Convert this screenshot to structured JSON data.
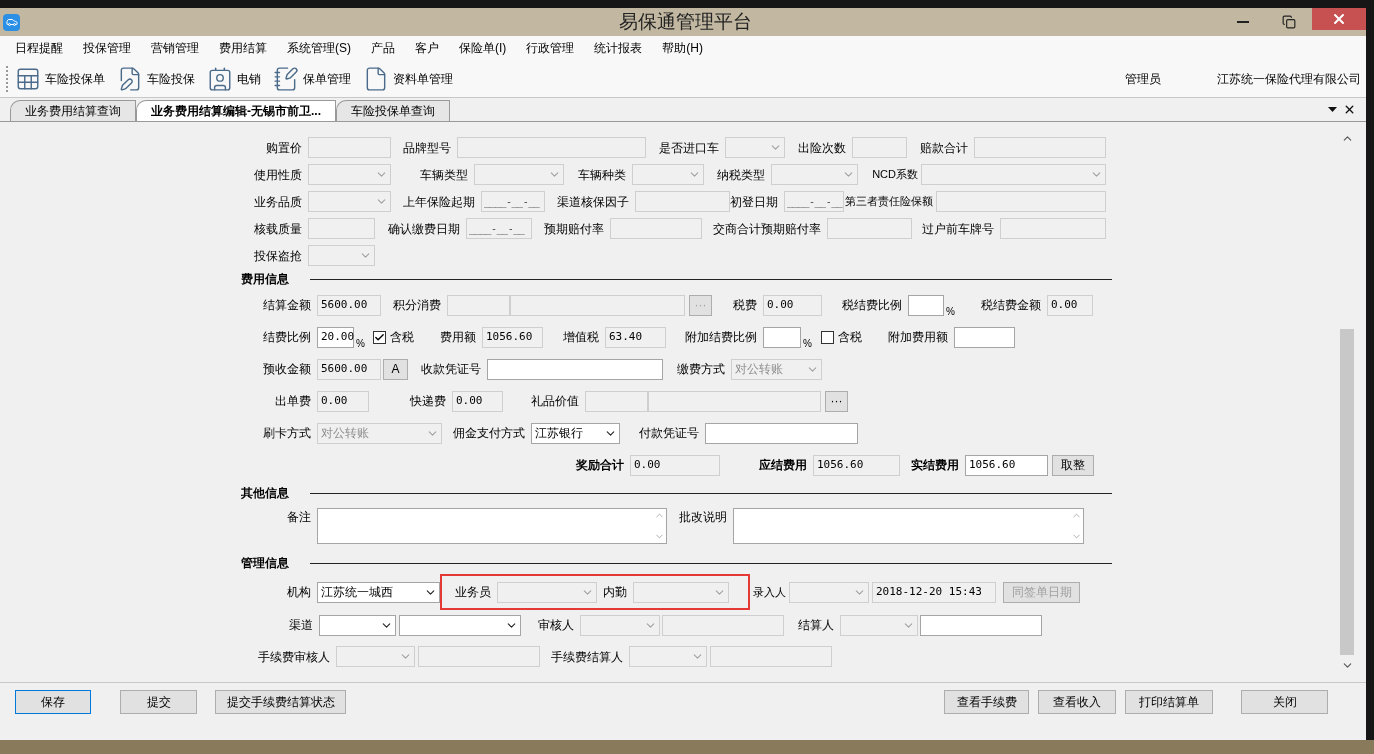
{
  "window": {
    "title": "易保通管理平台"
  },
  "menu": [
    "日程提醒",
    "投保管理",
    "营销管理",
    "费用结算",
    "系统管理(S)",
    "产品",
    "客户",
    "保险单(I)",
    "行政管理",
    "统计报表",
    "帮助(H)"
  ],
  "toolbar": {
    "items": [
      "车险投保单",
      "车险投保",
      "电销",
      "保单管理",
      "资料单管理"
    ],
    "user": "管理员",
    "company": "江苏统一保险代理有限公司"
  },
  "tabs": [
    {
      "label": "业务费用结算查询",
      "selected": false
    },
    {
      "label": "业务费用结算编辑-无锡市前卫...",
      "selected": true
    },
    {
      "label": "车险投保单查询",
      "selected": false
    }
  ],
  "form": {
    "sections": [
      {
        "rows": [
          {
            "items": [
              {
                "kind": "label",
                "text": "购置价"
              },
              {
                "kind": "text",
                "disabled": true
              },
              {
                "kind": "label",
                "text": "品牌型号"
              },
              {
                "kind": "text",
                "disabled": true
              },
              {
                "kind": "label",
                "text": "是否进口车"
              },
              {
                "kind": "select",
                "disabled": true
              },
              {
                "kind": "label",
                "text": "出险次数"
              },
              {
                "kind": "text",
                "disabled": true
              },
              {
                "kind": "label",
                "text": "赔款合计"
              },
              {
                "kind": "text",
                "disabled": true
              }
            ]
          },
          {
            "items": [
              {
                "kind": "label",
                "text": "使用性质"
              },
              {
                "kind": "select",
                "disabled": true
              },
              {
                "kind": "label",
                "text": "车辆类型"
              },
              {
                "kind": "select",
                "disabled": true
              },
              {
                "kind": "label",
                "text": "车辆种类"
              },
              {
                "kind": "select",
                "disabled": true
              },
              {
                "kind": "label",
                "text": "纳税类型"
              },
              {
                "kind": "select",
                "disabled": true
              },
              {
                "kind": "label",
                "text": "NCD系数"
              },
              {
                "kind": "select",
                "disabled": true
              }
            ]
          },
          {
            "items": [
              {
                "kind": "label",
                "text": "业务品质"
              },
              {
                "kind": "select",
                "disabled": true
              },
              {
                "kind": "label",
                "text": "上年保险起期"
              },
              {
                "kind": "date",
                "value": "____-__-__",
                "disabled": true
              },
              {
                "kind": "label",
                "text": "渠道核保因子"
              },
              {
                "kind": "text",
                "disabled": true
              },
              {
                "kind": "label",
                "text": "初登日期"
              },
              {
                "kind": "date",
                "value": "____-__-__",
                "disabled": true
              },
              {
                "kind": "label",
                "text": "第三者责任险保额"
              },
              {
                "kind": "text",
                "disabled": true
              }
            ]
          },
          {
            "items": [
              {
                "kind": "label",
                "text": "核载质量"
              },
              {
                "kind": "text",
                "disabled": true
              },
              {
                "kind": "label",
                "text": "确认缴费日期"
              },
              {
                "kind": "date",
                "value": "____-__-__",
                "disabled": true
              },
              {
                "kind": "label",
                "text": "预期赔付率"
              },
              {
                "kind": "text",
                "disabled": true
              },
              {
                "kind": "label",
                "text": "交商合计预期赔付率"
              },
              {
                "kind": "text",
                "disabled": true
              },
              {
                "kind": "label",
                "text": "过户前车牌号"
              },
              {
                "kind": "text",
                "disabled": true
              }
            ]
          },
          {
            "items": [
              {
                "kind": "label",
                "text": "投保盗抢"
              },
              {
                "kind": "select",
                "disabled": true
              }
            ]
          }
        ]
      },
      {
        "heading": "费用信息",
        "rows": [
          {
            "items": [
              {
                "kind": "label",
                "text": "结算金额"
              },
              {
                "kind": "text",
                "value": "5600.00",
                "disabled": true
              },
              {
                "kind": "label",
                "text": "积分消费"
              },
              {
                "kind": "text",
                "disabled": true
              },
              {
                "kind": "text",
                "disabled": true
              },
              {
                "kind": "button",
                "text": "···",
                "disabled": true
              },
              {
                "kind": "label",
                "text": "税费"
              },
              {
                "kind": "text",
                "value": "0.00",
                "disabled": true
              },
              {
                "kind": "label",
                "text": "税结费比例"
              },
              {
                "kind": "text",
                "disabled": false
              },
              {
                "kind": "unit",
                "text": "%"
              },
              {
                "kind": "label",
                "text": "税结费金额"
              },
              {
                "kind": "text",
                "value": "0.00",
                "disabled": true
              }
            ]
          },
          {
            "items": [
              {
                "kind": "label",
                "text": "结费比例"
              },
              {
                "kind": "text",
                "value": "20.00",
                "disabled": false
              },
              {
                "kind": "unit",
                "text": "%"
              },
              {
                "kind": "checkbox",
                "text": "含税",
                "checked": true
              },
              {
                "kind": "label",
                "text": "费用额"
              },
              {
                "kind": "text",
                "value": "1056.60",
                "disabled": true
              },
              {
                "kind": "label",
                "text": "增值税"
              },
              {
                "kind": "text",
                "value": "63.40",
                "disabled": true
              },
              {
                "kind": "label",
                "text": "附加结费比例"
              },
              {
                "kind": "text",
                "disabled": false
              },
              {
                "kind": "unit",
                "text": "%"
              },
              {
                "kind": "checkbox",
                "text": "含税",
                "checked": false
              },
              {
                "kind": "label",
                "text": "附加费用额"
              },
              {
                "kind": "text",
                "disabled": false
              }
            ]
          },
          {
            "items": [
              {
                "kind": "label",
                "text": "预收金额"
              },
              {
                "kind": "text",
                "value": "5600.00",
                "disabled": true
              },
              {
                "kind": "button",
                "text": "A",
                "disabled": false
              },
              {
                "kind": "label",
                "text": "收款凭证号"
              },
              {
                "kind": "text",
                "disabled": false
              },
              {
                "kind": "label",
                "text": "缴费方式"
              },
              {
                "kind": "select",
                "value": "对公转账",
                "disabled": true
              }
            ]
          },
          {
            "items": [
              {
                "kind": "label",
                "text": "出单费"
              },
              {
                "kind": "text",
                "value": "0.00",
                "disabled": true
              },
              {
                "kind": "label",
                "text": "快递费"
              },
              {
                "kind": "text",
                "value": "0.00",
                "disabled": true
              },
              {
                "kind": "label",
                "text": "礼品价值"
              },
              {
                "kind": "text",
                "disabled": true
              },
              {
                "kind": "text",
                "disabled": true
              },
              {
                "kind": "button",
                "text": "···",
                "disabled": false
              }
            ]
          },
          {
            "items": [
              {
                "kind": "label",
                "text": "刷卡方式"
              },
              {
                "kind": "select",
                "value": "对公转账",
                "disabled": true
              },
              {
                "kind": "label",
                "text": "佣金支付方式"
              },
              {
                "kind": "select",
                "value": "江苏银行",
                "disabled": false
              },
              {
                "kind": "label",
                "text": "付款凭证号"
              },
              {
                "kind": "text",
                "disabled": false
              }
            ]
          },
          {
            "items": [
              {
                "kind": "strong_label",
                "text": "奖励合计"
              },
              {
                "kind": "text",
                "value": "0.00",
                "disabled": true
              },
              {
                "kind": "strong_label",
                "text": "应结费用"
              },
              {
                "kind": "text",
                "value": "1056.60",
                "disabled": true
              },
              {
                "kind": "strong_label",
                "text": "实结费用"
              },
              {
                "kind": "text",
                "value": "1056.60",
                "disabled": false
              },
              {
                "kind": "button",
                "text": "取整",
                "disabled": false
              }
            ]
          }
        ]
      },
      {
        "heading": "其他信息",
        "rows": [
          {
            "items": [
              {
                "kind": "label",
                "text": "备注"
              },
              {
                "kind": "textarea",
                "disabled": false
              },
              {
                "kind": "label",
                "text": "批改说明"
              },
              {
                "kind": "textarea",
                "disabled": false
              }
            ]
          }
        ]
      },
      {
        "heading": "管理信息",
        "rows": [
          {
            "items": [
              {
                "kind": "label",
                "text": "机构"
              },
              {
                "kind": "select",
                "value": "江苏统一城西",
                "disabled": false
              },
              {
                "kind": "highlight",
                "items": [
                  {
                    "kind": "label",
                    "text": "业务员"
                  },
                  {
                    "kind": "select",
                    "disabled": true
                  },
                  {
                    "kind": "label",
                    "text": "内勤"
                  },
                  {
                    "kind": "select",
                    "disabled": true
                  }
                ]
              },
              {
                "kind": "label",
                "text": "录入人"
              },
              {
                "kind": "select",
                "disabled": true
              },
              {
                "kind": "text",
                "value": "2018-12-20 15:43",
                "disabled": true
              },
              {
                "kind": "button",
                "text": "同签单日期",
                "disabled": true
              }
            ]
          },
          {
            "items": [
              {
                "kind": "label",
                "text": "渠道"
              },
              {
                "kind": "select",
                "disabled": false
              },
              {
                "kind": "select",
                "disabled": false
              },
              {
                "kind": "label",
                "text": "审核人"
              },
              {
                "kind": "select",
                "disabled": true
              },
              {
                "kind": "text",
                "disabled": true
              },
              {
                "kind": "label",
                "text": "结算人"
              },
              {
                "kind": "select",
                "disabled": true
              },
              {
                "kind": "text",
                "disabled": false
              }
            ]
          },
          {
            "items": [
              {
                "kind": "label",
                "text": "手续费审核人"
              },
              {
                "kind": "select",
                "disabled": true
              },
              {
                "kind": "text",
                "disabled": true
              },
              {
                "kind": "label",
                "text": "手续费结算人"
              },
              {
                "kind": "select",
                "disabled": true
              },
              {
                "kind": "text",
                "disabled": true
              }
            ]
          }
        ]
      }
    ]
  },
  "buttons_left": [
    {
      "label": "保存",
      "focused": true
    },
    {
      "label": "提交",
      "focused": false
    },
    {
      "label": "提交手续费结算状态",
      "focused": false
    }
  ],
  "buttons_right": [
    {
      "label": "查看手续费",
      "focused": false
    },
    {
      "label": "查看收入",
      "focused": false
    },
    {
      "label": "打印结算单",
      "focused": false
    },
    {
      "label": "关闭",
      "focused": false
    }
  ]
}
